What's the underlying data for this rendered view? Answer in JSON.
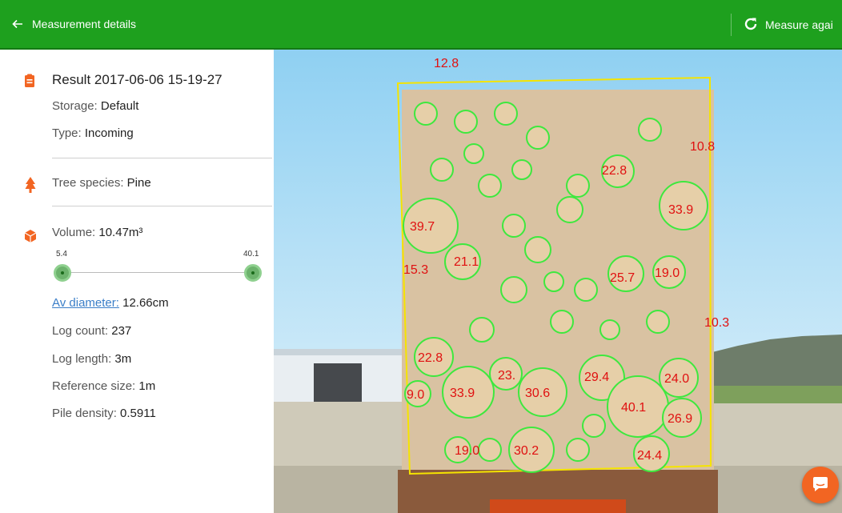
{
  "header": {
    "title": "Measurement details",
    "action_label": "Measure agai"
  },
  "details": {
    "result_title": "Result 2017-06-06 15-19-27",
    "storage_label": "Storage:",
    "storage_value": "Default",
    "type_label": "Type:",
    "type_value": "Incoming",
    "species_label": "Tree species:",
    "species_value": "Pine",
    "volume_label": "Volume:",
    "volume_value": "10.47m³",
    "range_min": "5.4",
    "range_max": "40.1",
    "avg_diameter_label": "Av diameter:",
    "avg_diameter_value": "12.66cm",
    "log_count_label": "Log count:",
    "log_count_value": "237",
    "log_length_label": "Log length:",
    "log_length_value": "3m",
    "reference_label": "Reference size:",
    "reference_value": "1m",
    "density_label": "Pile density:",
    "density_value": "0.5911"
  },
  "photo": {
    "diameter_labels": [
      "12.8",
      "39.7",
      "33.9",
      "21.1",
      "25.7",
      "19.0",
      "22.8",
      "33.9",
      "30.6",
      "29.4",
      "40.1",
      "24.0",
      "26.9",
      "30.2",
      "24.4",
      "19.0",
      "23.",
      "22.8",
      "9.0",
      "15.3",
      "10.3",
      "10.8"
    ],
    "accent_colors": {
      "outline": "#3ee83e",
      "label": "#e01010",
      "frame": "#f5e400"
    }
  },
  "colors": {
    "topbar": "#1ea01e",
    "slider": "#6db36d",
    "link": "#3a7ec8",
    "fab": "#f26522"
  }
}
